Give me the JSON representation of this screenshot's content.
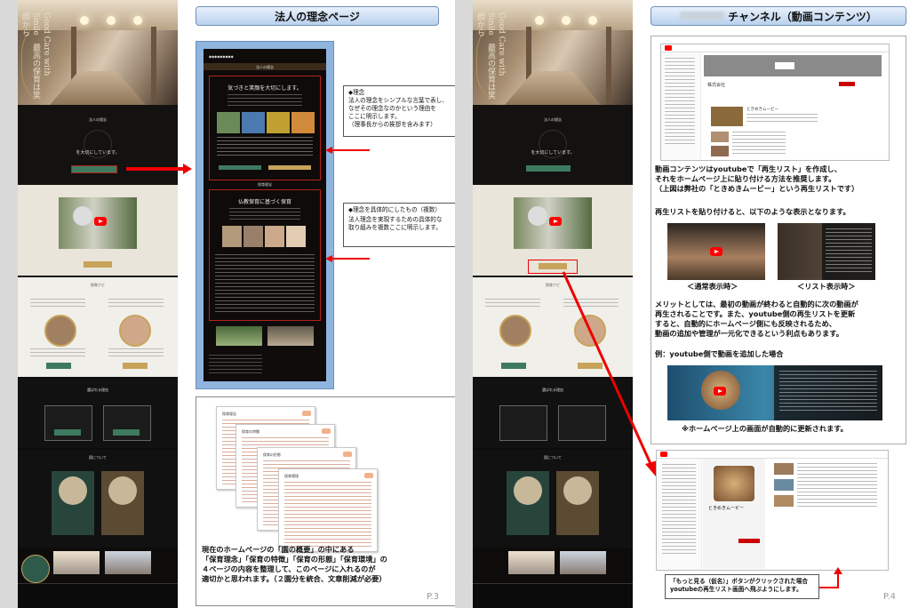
{
  "page3": {
    "title": "法人の理念ページ",
    "page_number": "P.3",
    "mock": {
      "hero_vertical": "Good Care with Smile　最高の保育は笑顔から",
      "section_intro": "法人の理念",
      "tagline": "を大切にしています。",
      "sec_childcare": "保育ナビ",
      "sec_reason": "選ばれる理由",
      "sec_facilities": "園について"
    },
    "panel": {
      "header": "法人の理念",
      "block1_title": "気づきと笑顔を大切にします。",
      "block2_header": "保育理念",
      "block2_title": "仏教保育に基づく保育"
    },
    "note1": {
      "heading": "◆理念",
      "lines": [
        "法人の理念をシンプルな言葉で表し、",
        "なぜその理念なのかという理由を",
        "ここに明示します。",
        "（理事長からの挨拶を含みます）"
      ]
    },
    "note2": {
      "heading": "◆理念を具体的にしたもの（複数）",
      "lines": [
        "法人理念を実現するための具体的な",
        "取り組みを複数ここに明示します。"
      ]
    },
    "docs": [
      "保育理念",
      "保育の特徴",
      "保育の形態",
      "保育環境"
    ],
    "bottom_text": [
      "現在のホームページの「園の概要」の中にある",
      "「保育理念」「保育の特徴」「保育の形態」「保育環境」の",
      "４ページの内容を整理して、このページに入れるのが",
      "適切かと思われます。（２園分を統合、文章削減が必要）"
    ]
  },
  "page4": {
    "title": "チャンネル（動画コンテンツ）",
    "page_number": "P.4",
    "yt_channel_name": "株式会社",
    "yt_playlist_name": "ときめきムービー",
    "text1": [
      "動画コンテンツはyoutubeで「再生リスト」を作成し、",
      "それをホームページ上に貼り付ける方法を推奨します。",
      "（上図は弊社の「ときめきムービー」という再生リストです）"
    ],
    "text2": "再生リストを貼り付けると、以下のような表示となります。",
    "label_normal": "＜通常表示時＞",
    "label_list": "＜リスト表示時＞",
    "text3": [
      "メリットとしては、最初の動画が終わると自動的に次の動画が",
      "再生されることです。また、youtube側の再生リストを更新",
      "すると、自動的にホームページ側にも反映されるため、",
      "動画の追加や管理が一元化できるという利点もあります。"
    ],
    "text4": "例：youtube側で動画を追加した場合",
    "text5": "※ホームページ上の画面が自動的に更新されます。",
    "yt_playlist_bottom": "ときめきムービー",
    "bottom_note": [
      "「もっと見る（仮名）」ボタンがクリックされた場合",
      "youtubeの再生リスト画面へ飛ぶようにします。"
    ]
  },
  "colors": {
    "red_arrow": "#e60000",
    "title_bar": "#b9d1ee",
    "panel_blue": "#8fb4de"
  }
}
